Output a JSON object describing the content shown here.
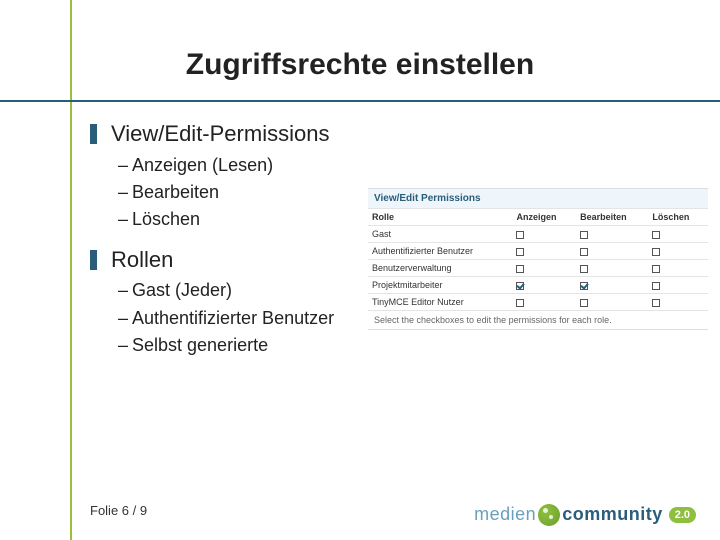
{
  "title": "Zugriffsrechte einstellen",
  "section1": {
    "heading": "View/Edit-Permissions",
    "items": [
      "Anzeigen (Lesen)",
      "Bearbeiten",
      "Löschen"
    ]
  },
  "section2": {
    "heading": "Rollen",
    "items": [
      "Gast (Jeder)",
      "Authentifizierter Benutzer",
      "Selbst generierte"
    ]
  },
  "screenshot": {
    "title": "View/Edit Permissions",
    "headers": [
      "Rolle",
      "Anzeigen",
      "Bearbeiten",
      "Löschen"
    ],
    "rows": [
      {
        "label": "Gast",
        "cells": [
          false,
          false,
          false
        ]
      },
      {
        "label": "Authentifizierter Benutzer",
        "cells": [
          false,
          false,
          false
        ]
      },
      {
        "label": "Benutzerverwaltung",
        "cells": [
          false,
          false,
          false
        ]
      },
      {
        "label": "Projektmitarbeiter",
        "cells": [
          true,
          true,
          false
        ]
      },
      {
        "label": "TinyMCE Editor Nutzer",
        "cells": [
          false,
          false,
          false
        ]
      }
    ],
    "note": "Select the checkboxes to edit the permissions for each role."
  },
  "footer": {
    "label": "Folie 6 / 9"
  },
  "logo": {
    "word1": "medien",
    "word2": "community",
    "badge": "2.0"
  }
}
